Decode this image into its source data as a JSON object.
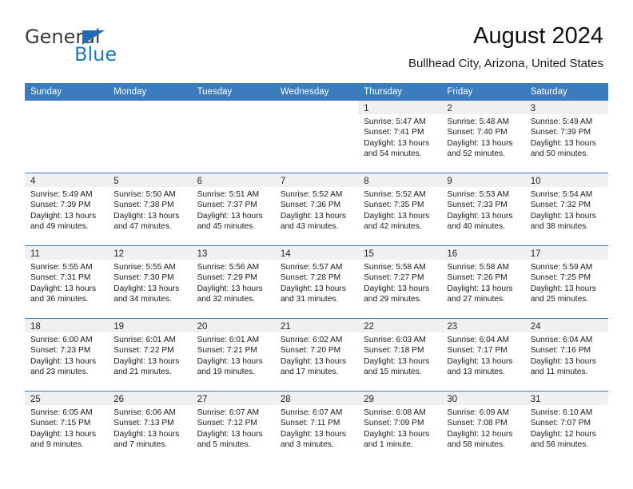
{
  "brand": {
    "name_top": "General",
    "name_bottom": "Blue",
    "triangle_color": "#1f6eb5",
    "blue_color": "#1f7bc4"
  },
  "header": {
    "title": "August 2024",
    "subtitle": "Bullhead City, Arizona, United States"
  },
  "theme": {
    "header_bg": "#3a7cbe",
    "header_text": "#ffffff",
    "daynum_band_bg": "#f0f0f0",
    "row_divider": "#3a7cbe"
  },
  "calendar": {
    "weekday_headers": [
      "Sunday",
      "Monday",
      "Tuesday",
      "Wednesday",
      "Thursday",
      "Friday",
      "Saturday"
    ],
    "labels": {
      "sunrise": "Sunrise:",
      "sunset": "Sunset:",
      "daylight": "Daylight:"
    },
    "weeks": [
      [
        {
          "day": ""
        },
        {
          "day": ""
        },
        {
          "day": ""
        },
        {
          "day": ""
        },
        {
          "day": "1",
          "sunrise": "Sunrise: 5:47 AM",
          "sunset": "Sunset: 7:41 PM",
          "daylight": "Daylight: 13 hours and 54 minutes."
        },
        {
          "day": "2",
          "sunrise": "Sunrise: 5:48 AM",
          "sunset": "Sunset: 7:40 PM",
          "daylight": "Daylight: 13 hours and 52 minutes."
        },
        {
          "day": "3",
          "sunrise": "Sunrise: 5:49 AM",
          "sunset": "Sunset: 7:39 PM",
          "daylight": "Daylight: 13 hours and 50 minutes."
        }
      ],
      [
        {
          "day": "4",
          "sunrise": "Sunrise: 5:49 AM",
          "sunset": "Sunset: 7:39 PM",
          "daylight": "Daylight: 13 hours and 49 minutes."
        },
        {
          "day": "5",
          "sunrise": "Sunrise: 5:50 AM",
          "sunset": "Sunset: 7:38 PM",
          "daylight": "Daylight: 13 hours and 47 minutes."
        },
        {
          "day": "6",
          "sunrise": "Sunrise: 5:51 AM",
          "sunset": "Sunset: 7:37 PM",
          "daylight": "Daylight: 13 hours and 45 minutes."
        },
        {
          "day": "7",
          "sunrise": "Sunrise: 5:52 AM",
          "sunset": "Sunset: 7:36 PM",
          "daylight": "Daylight: 13 hours and 43 minutes."
        },
        {
          "day": "8",
          "sunrise": "Sunrise: 5:52 AM",
          "sunset": "Sunset: 7:35 PM",
          "daylight": "Daylight: 13 hours and 42 minutes."
        },
        {
          "day": "9",
          "sunrise": "Sunrise: 5:53 AM",
          "sunset": "Sunset: 7:33 PM",
          "daylight": "Daylight: 13 hours and 40 minutes."
        },
        {
          "day": "10",
          "sunrise": "Sunrise: 5:54 AM",
          "sunset": "Sunset: 7:32 PM",
          "daylight": "Daylight: 13 hours and 38 minutes."
        }
      ],
      [
        {
          "day": "11",
          "sunrise": "Sunrise: 5:55 AM",
          "sunset": "Sunset: 7:31 PM",
          "daylight": "Daylight: 13 hours and 36 minutes."
        },
        {
          "day": "12",
          "sunrise": "Sunrise: 5:55 AM",
          "sunset": "Sunset: 7:30 PM",
          "daylight": "Daylight: 13 hours and 34 minutes."
        },
        {
          "day": "13",
          "sunrise": "Sunrise: 5:56 AM",
          "sunset": "Sunset: 7:29 PM",
          "daylight": "Daylight: 13 hours and 32 minutes."
        },
        {
          "day": "14",
          "sunrise": "Sunrise: 5:57 AM",
          "sunset": "Sunset: 7:28 PM",
          "daylight": "Daylight: 13 hours and 31 minutes."
        },
        {
          "day": "15",
          "sunrise": "Sunrise: 5:58 AM",
          "sunset": "Sunset: 7:27 PM",
          "daylight": "Daylight: 13 hours and 29 minutes."
        },
        {
          "day": "16",
          "sunrise": "Sunrise: 5:58 AM",
          "sunset": "Sunset: 7:26 PM",
          "daylight": "Daylight: 13 hours and 27 minutes."
        },
        {
          "day": "17",
          "sunrise": "Sunrise: 5:59 AM",
          "sunset": "Sunset: 7:25 PM",
          "daylight": "Daylight: 13 hours and 25 minutes."
        }
      ],
      [
        {
          "day": "18",
          "sunrise": "Sunrise: 6:00 AM",
          "sunset": "Sunset: 7:23 PM",
          "daylight": "Daylight: 13 hours and 23 minutes."
        },
        {
          "day": "19",
          "sunrise": "Sunrise: 6:01 AM",
          "sunset": "Sunset: 7:22 PM",
          "daylight": "Daylight: 13 hours and 21 minutes."
        },
        {
          "day": "20",
          "sunrise": "Sunrise: 6:01 AM",
          "sunset": "Sunset: 7:21 PM",
          "daylight": "Daylight: 13 hours and 19 minutes."
        },
        {
          "day": "21",
          "sunrise": "Sunrise: 6:02 AM",
          "sunset": "Sunset: 7:20 PM",
          "daylight": "Daylight: 13 hours and 17 minutes."
        },
        {
          "day": "22",
          "sunrise": "Sunrise: 6:03 AM",
          "sunset": "Sunset: 7:18 PM",
          "daylight": "Daylight: 13 hours and 15 minutes."
        },
        {
          "day": "23",
          "sunrise": "Sunrise: 6:04 AM",
          "sunset": "Sunset: 7:17 PM",
          "daylight": "Daylight: 13 hours and 13 minutes."
        },
        {
          "day": "24",
          "sunrise": "Sunrise: 6:04 AM",
          "sunset": "Sunset: 7:16 PM",
          "daylight": "Daylight: 13 hours and 11 minutes."
        }
      ],
      [
        {
          "day": "25",
          "sunrise": "Sunrise: 6:05 AM",
          "sunset": "Sunset: 7:15 PM",
          "daylight": "Daylight: 13 hours and 9 minutes."
        },
        {
          "day": "26",
          "sunrise": "Sunrise: 6:06 AM",
          "sunset": "Sunset: 7:13 PM",
          "daylight": "Daylight: 13 hours and 7 minutes."
        },
        {
          "day": "27",
          "sunrise": "Sunrise: 6:07 AM",
          "sunset": "Sunset: 7:12 PM",
          "daylight": "Daylight: 13 hours and 5 minutes."
        },
        {
          "day": "28",
          "sunrise": "Sunrise: 6:07 AM",
          "sunset": "Sunset: 7:11 PM",
          "daylight": "Daylight: 13 hours and 3 minutes."
        },
        {
          "day": "29",
          "sunrise": "Sunrise: 6:08 AM",
          "sunset": "Sunset: 7:09 PM",
          "daylight": "Daylight: 13 hours and 1 minute."
        },
        {
          "day": "30",
          "sunrise": "Sunrise: 6:09 AM",
          "sunset": "Sunset: 7:08 PM",
          "daylight": "Daylight: 12 hours and 58 minutes."
        },
        {
          "day": "31",
          "sunrise": "Sunrise: 6:10 AM",
          "sunset": "Sunset: 7:07 PM",
          "daylight": "Daylight: 12 hours and 56 minutes."
        }
      ]
    ]
  }
}
